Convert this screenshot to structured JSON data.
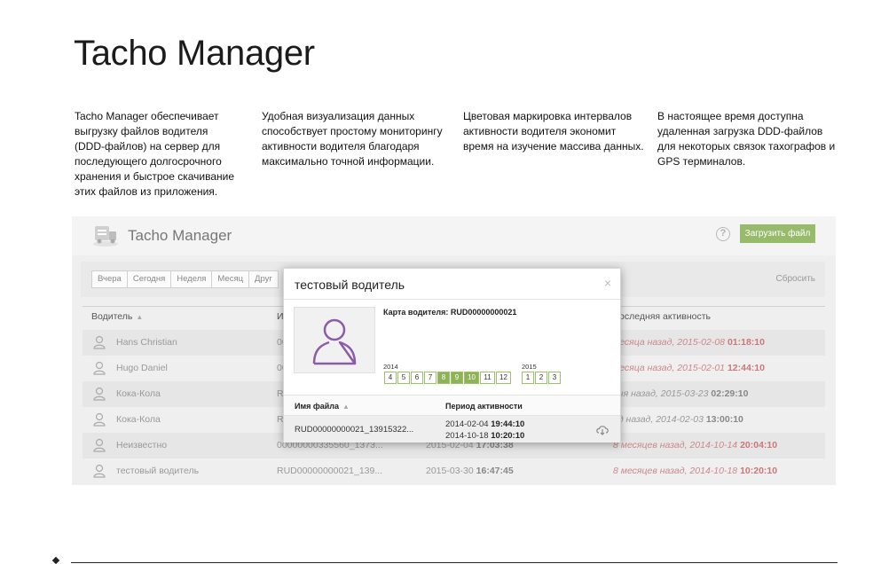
{
  "page": {
    "title": "Tacho Manager",
    "features": [
      "Tacho Manager обеспечивает выгрузку файлов водителя (DDD-файлов) на сервер для последующего долгосрочного хранения и быстрое скачивание этих файлов из приложения.",
      "Удобная визуализация данных способствует простому мониторингу активности водителя благодаря максимально точной информации.",
      "Цветовая маркировка интервалов активности водителя экономит время на изучение массива данных.",
      "В настоящее время доступна удаленная загрузка DDD-файлов для некоторых связок тахографов и GPS терминалов."
    ]
  },
  "app": {
    "title": "Tacho Manager",
    "help_label": "?",
    "upload_label": "Загрузить файл",
    "filters": [
      "Вчера",
      "Сегодня",
      "Неделя",
      "Месяц",
      "Друг"
    ],
    "reset_label": "Сбросить",
    "columns": {
      "driver": "Водитель",
      "id": "И",
      "last_activity": "оследняя активность"
    },
    "rows": [
      {
        "name": "Hans Christian",
        "card": "00",
        "start": "",
        "start_time": "",
        "ago": "месяца назад,",
        "date": "2015-02-08",
        "time": "01:18:10"
      },
      {
        "name": "Hugo Daniel",
        "card": "00",
        "start": "",
        "start_time": "",
        "ago": "месяца назад,",
        "date": "2015-02-01",
        "time": "12:44:10"
      },
      {
        "name": "Кока-Кола",
        "card": "R",
        "start": "",
        "start_time": "",
        "ago": "дня назад,",
        "date": "2015-03-23",
        "time": "02:29:10"
      },
      {
        "name": "Кока-Кола",
        "card": "R",
        "start": "",
        "start_time": "",
        "ago": "од назад,",
        "date": "2014-02-03",
        "time": "13:00:10"
      },
      {
        "name": "Неизвестно",
        "card": "00000000335560_1373...",
        "start": "2015-02-04",
        "start_time": "17:03:38",
        "ago": "8 месяцев назад,",
        "date": "2014-10-14",
        "time": "20:04:10"
      },
      {
        "name": "тестовый водитель",
        "card": "RUD00000000021_139...",
        "start": "2015-03-30",
        "start_time": "16:47:45",
        "ago": "8 месяцев назад,",
        "date": "2014-10-18",
        "time": "10:20:10"
      }
    ]
  },
  "modal": {
    "title": "тестовый водитель",
    "close_label": "×",
    "card_label": "Карта водителя: RUD00000000021",
    "year_2014": "2014",
    "year_2015": "2015",
    "months_2014": [
      {
        "label": "4",
        "active": false
      },
      {
        "label": "5",
        "active": false
      },
      {
        "label": "6",
        "active": false
      },
      {
        "label": "7",
        "active": false
      },
      {
        "label": "8",
        "active": true
      },
      {
        "label": "9",
        "active": true
      },
      {
        "label": "10",
        "active": true
      },
      {
        "label": "11",
        "active": false
      },
      {
        "label": "12",
        "active": false
      }
    ],
    "months_2015": [
      {
        "label": "1",
        "active": false
      },
      {
        "label": "2",
        "active": false
      },
      {
        "label": "3",
        "active": false
      }
    ],
    "table": {
      "file_header": "Имя файла",
      "period_header": "Период активности",
      "file_name": "RUD00000000021_13915322...",
      "period_start_date": "2014-02-04",
      "period_start_time": "19:44:10",
      "period_end_date": "2014-10-18",
      "period_end_time": "10:20:10"
    }
  },
  "colors": {
    "accent_green": "#8cb355",
    "upload_green": "#97bb6b",
    "muted_red": "#c77"
  }
}
